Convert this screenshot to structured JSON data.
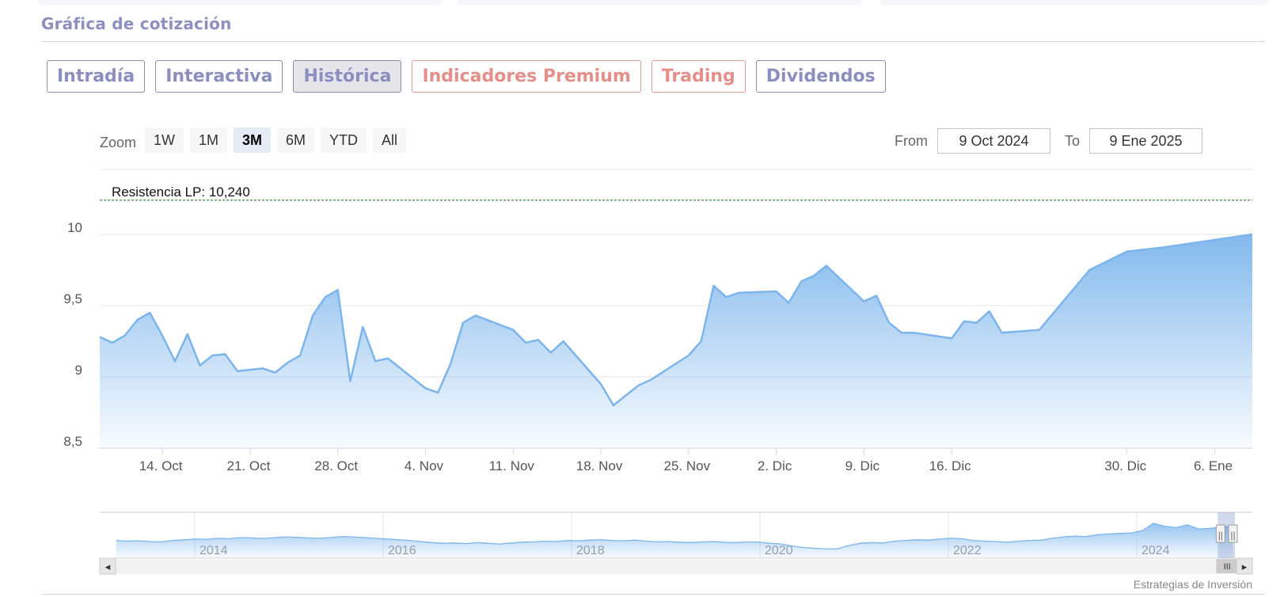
{
  "section": {
    "title": "Gráfica de cotización"
  },
  "tabs": [
    {
      "label": "Intradía",
      "state": "normal"
    },
    {
      "label": "Interactiva",
      "state": "normal"
    },
    {
      "label": "Histórica",
      "state": "active"
    },
    {
      "label": "Indicadores Premium",
      "state": "premium"
    },
    {
      "label": "Trading",
      "state": "premium"
    },
    {
      "label": "Dividendos",
      "state": "normal"
    }
  ],
  "zoom": {
    "label": "Zoom",
    "buttons": [
      "1W",
      "1M",
      "3M",
      "6M",
      "YTD",
      "All"
    ],
    "selected": "3M"
  },
  "range": {
    "from_label": "From",
    "from_value": "9 Oct 2024",
    "to_label": "To",
    "to_value": "9 Ene 2025"
  },
  "colors": {
    "line": "#7cb5ec",
    "resistance": "#2e7d32",
    "tab_text": "#8b8fc0",
    "premium": "#e48f89"
  },
  "chart_data": {
    "type": "area",
    "y_ticks": [
      "10",
      "9,5",
      "9",
      "8,5"
    ],
    "y_tick_values": [
      10,
      9.5,
      9,
      8.5
    ],
    "ylim": [
      8.5,
      10.5
    ],
    "grid": "horizontal",
    "x_ticks": [
      "14. Oct",
      "21. Oct",
      "28. Oct",
      "4. Nov",
      "11. Nov",
      "18. Nov",
      "25. Nov",
      "2. Dic",
      "9. Dic",
      "16. Dic",
      "30. Dic",
      "6. Ene"
    ],
    "x_tick_dates": [
      "2024-10-14",
      "2024-10-21",
      "2024-10-28",
      "2024-11-04",
      "2024-11-11",
      "2024-11-18",
      "2024-11-25",
      "2024-12-02",
      "2024-12-09",
      "2024-12-16",
      "2024-12-30",
      "2025-01-06"
    ],
    "resistance": {
      "label": "Resistencia LP: 10,240",
      "value": 10.24
    },
    "series": [
      {
        "points": [
          [
            "2024-10-09",
            9.28
          ],
          [
            "2024-10-10",
            9.24
          ],
          [
            "2024-10-11",
            9.29
          ],
          [
            "2024-10-12",
            9.4
          ],
          [
            "2024-10-13",
            9.45
          ],
          [
            "2024-10-14",
            9.29
          ],
          [
            "2024-10-15",
            9.11
          ],
          [
            "2024-10-16",
            9.3
          ],
          [
            "2024-10-17",
            9.08
          ],
          [
            "2024-10-18",
            9.15
          ],
          [
            "2024-10-19",
            9.16
          ],
          [
            "2024-10-20",
            9.04
          ],
          [
            "2024-10-21",
            9.05
          ],
          [
            "2024-10-22",
            9.06
          ],
          [
            "2024-10-23",
            9.03
          ],
          [
            "2024-10-24",
            9.1
          ],
          [
            "2024-10-25",
            9.15
          ],
          [
            "2024-10-26",
            9.43
          ],
          [
            "2024-10-27",
            9.56
          ],
          [
            "2024-10-28",
            9.61
          ],
          [
            "2024-10-29",
            8.97
          ],
          [
            "2024-10-30",
            9.35
          ],
          [
            "2024-10-31",
            9.11
          ],
          [
            "2024-11-01",
            9.13
          ],
          [
            "2024-11-04",
            8.92
          ],
          [
            "2024-11-05",
            8.89
          ],
          [
            "2024-11-06",
            9.09
          ],
          [
            "2024-11-07",
            9.38
          ],
          [
            "2024-11-08",
            9.43
          ],
          [
            "2024-11-11",
            9.33
          ],
          [
            "2024-11-12",
            9.24
          ],
          [
            "2024-11-13",
            9.26
          ],
          [
            "2024-11-14",
            9.17
          ],
          [
            "2024-11-15",
            9.25
          ],
          [
            "2024-11-18",
            8.95
          ],
          [
            "2024-11-19",
            8.8
          ],
          [
            "2024-11-20",
            8.87
          ],
          [
            "2024-11-21",
            8.94
          ],
          [
            "2024-11-22",
            8.98
          ],
          [
            "2024-11-25",
            9.15
          ],
          [
            "2024-11-26",
            9.25
          ],
          [
            "2024-11-27",
            9.64
          ],
          [
            "2024-11-28",
            9.56
          ],
          [
            "2024-11-29",
            9.59
          ],
          [
            "2024-12-02",
            9.6
          ],
          [
            "2024-12-03",
            9.52
          ],
          [
            "2024-12-04",
            9.67
          ],
          [
            "2024-12-05",
            9.71
          ],
          [
            "2024-12-06",
            9.78
          ],
          [
            "2024-12-09",
            9.53
          ],
          [
            "2024-12-10",
            9.57
          ],
          [
            "2024-12-11",
            9.38
          ],
          [
            "2024-12-12",
            9.31
          ],
          [
            "2024-12-13",
            9.31
          ],
          [
            "2024-12-16",
            9.27
          ],
          [
            "2024-12-17",
            9.39
          ],
          [
            "2024-12-18",
            9.38
          ],
          [
            "2024-12-19",
            9.46
          ],
          [
            "2024-12-20",
            9.31
          ],
          [
            "2024-12-23",
            9.33
          ],
          [
            "2024-12-27",
            9.75
          ],
          [
            "2024-12-30",
            9.88
          ],
          [
            "2025-01-02",
            9.91
          ],
          [
            "2025-01-09",
            10.0
          ]
        ]
      }
    ]
  },
  "navigator": {
    "labels": [
      "2014",
      "2016",
      "2018",
      "2020",
      "2022",
      "2024"
    ],
    "values": [
      9.1,
      9.05,
      9.08,
      9.02,
      9.0,
      9.1,
      9.15,
      9.2,
      9.18,
      9.25,
      9.22,
      9.3,
      9.28,
      9.24,
      9.3,
      9.35,
      9.32,
      9.28,
      9.25,
      9.3,
      9.38,
      9.35,
      9.3,
      9.25,
      9.2,
      9.15,
      9.1,
      9.02,
      8.95,
      8.9,
      8.92,
      8.88,
      8.95,
      8.9,
      8.85,
      8.92,
      8.98,
      9.0,
      9.05,
      9.02,
      9.1,
      9.08,
      9.12,
      9.15,
      9.1,
      9.08,
      9.12,
      9.05,
      9.0,
      9.02,
      8.98,
      8.95,
      9.0,
      9.02,
      8.97,
      8.95,
      9.0,
      8.98,
      8.9,
      8.85,
      8.7,
      8.6,
      8.55,
      8.5,
      8.52,
      8.75,
      8.9,
      8.95,
      8.92,
      9.05,
      9.1,
      9.15,
      9.12,
      9.2,
      9.25,
      9.22,
      9.1,
      9.05,
      9.02,
      8.98,
      9.05,
      9.1,
      9.12,
      9.25,
      9.35,
      9.4,
      9.38,
      9.5,
      9.55,
      9.6,
      9.62,
      9.8,
      10.3,
      10.1,
      10.0,
      10.2,
      9.9,
      9.95,
      10.05,
      10.1
    ],
    "scroll_left": "◂",
    "scroll_right": "▸",
    "grip": "III",
    "handle_grip": "||",
    "window_start": 0.97
  },
  "credit": "Estrategias de Inversión"
}
